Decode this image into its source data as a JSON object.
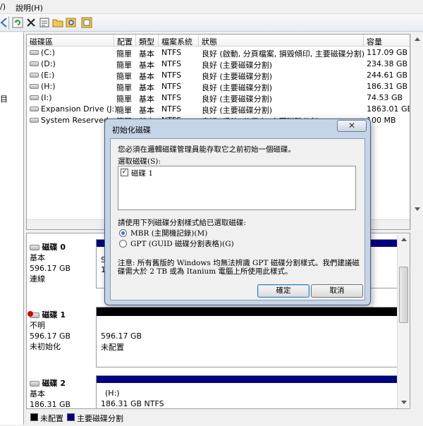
{
  "menu": {
    "partial": "/)",
    "help": "說明(H)"
  },
  "toolbar": {
    "icons": [
      "back-icon",
      "refresh-icon",
      "delete-icon",
      "properties-icon",
      "open-folder-icon",
      "search-icon",
      "help-icon"
    ]
  },
  "volume_list": {
    "columns": [
      "磁碟區",
      "配置",
      "類型",
      "檔案系統",
      "狀態",
      "容量"
    ],
    "rows": [
      {
        "name": "(C:)",
        "layout": "簡單",
        "type": "基本",
        "fs": "NTFS",
        "status": "良好 (啟動, 分頁檔案, 損毀傾印, 主要磁碟分割)",
        "capacity": "117.09 GB"
      },
      {
        "name": "(D:)",
        "layout": "簡單",
        "type": "基本",
        "fs": "NTFS",
        "status": "良好 (主要磁碟分割)",
        "capacity": "234.38 GB"
      },
      {
        "name": "(E:)",
        "layout": "簡單",
        "type": "基本",
        "fs": "NTFS",
        "status": "良好 (主要磁碟分割)",
        "capacity": "244.61 GB"
      },
      {
        "name": "(H:)",
        "layout": "簡單",
        "type": "基本",
        "fs": "NTFS",
        "status": "良好 (主要磁碟分割)",
        "capacity": "186.31 GB"
      },
      {
        "name": "(I:)",
        "layout": "簡單",
        "type": "基本",
        "fs": "NTFS",
        "status": "良好 (主要磁碟分割)",
        "capacity": "74.53 GB"
      },
      {
        "name": "Expansion Drive (J:)",
        "layout": "簡單",
        "type": "基本",
        "fs": "NTFS",
        "status": "良好 (主要磁碟分割)",
        "capacity": "1863.01 GB"
      },
      {
        "name": "System Reserved",
        "layout": "簡單",
        "type": "基本",
        "fs": "NTFS",
        "status": "良好 (系統, 使用中, 主要磁碟分割)",
        "capacity": "100 MB"
      }
    ]
  },
  "disks": [
    {
      "title": "磁碟 0",
      "type": "基本",
      "size": "596.17 GB",
      "state": "連線",
      "partition_text": "S",
      "partition_line2": "1",
      "bar_color": "#000080"
    },
    {
      "title": "磁碟 1",
      "type": "不明",
      "size": "596.17 GB",
      "state": "未初始化",
      "partition_size": "596.17 GB",
      "partition_state": "未配置",
      "bar_color": "#000000"
    },
    {
      "title": "磁碟 2",
      "type": "基本",
      "size": "186.31 GB",
      "partition_name": "(H:)",
      "partition_size": "186.31 GB NTFS",
      "bar_color": "#000080"
    }
  ],
  "legend": {
    "items": [
      {
        "label": "未配置",
        "color": "#000000"
      },
      {
        "label": "主要磁碟分割",
        "color": "#000080"
      }
    ]
  },
  "dialog": {
    "title": "初始化磁碟",
    "close_glyph": "✕",
    "intro": "您必須在邏輯磁碟管理員能存取它之前初始一個磁碟。",
    "select_label": "選取磁碟(S):",
    "disk_item": "磁碟 1",
    "style_label": "請使用下列磁碟分割樣式給已選取磁碟:",
    "option_mbr": "MBR (主開機記錄)(M)",
    "option_gpt": "GPT (GUID 磁碟分割表格)(G)",
    "note_line1": "注意: 所有舊版的 Windows 均無法辨識 GPT 磁碟分割樣式。我們建議磁",
    "note_line2": "碟需大於 2 TB 或為 Itanium 電腦上所使用此樣式。",
    "ok_label": "確定",
    "cancel_label": "取消"
  }
}
